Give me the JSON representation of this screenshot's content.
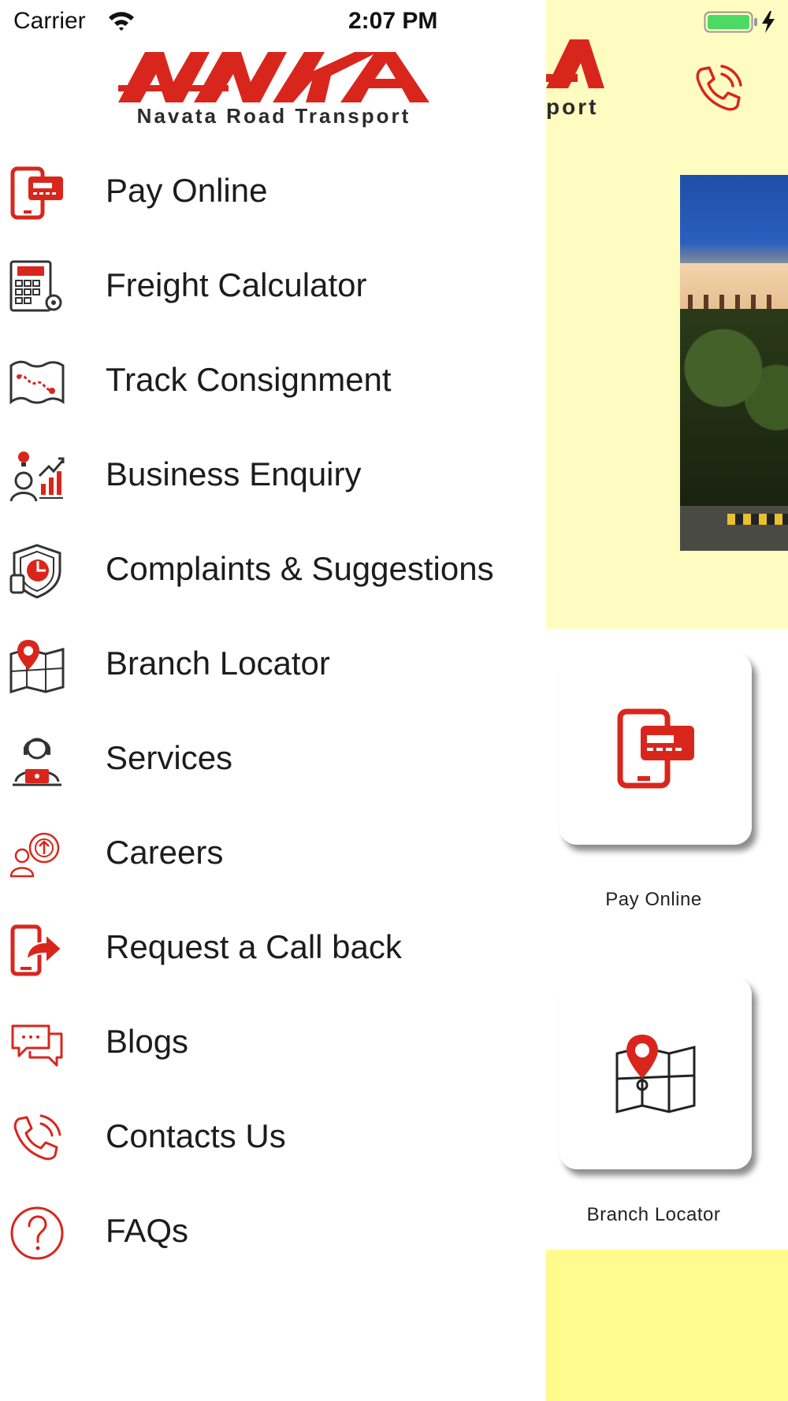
{
  "status_bar": {
    "carrier": "Carrier",
    "time": "2:07 PM"
  },
  "brand": {
    "logo_text": "NAVATA",
    "subtitle": "Navata Road Transport",
    "accent_color": "#d9261c"
  },
  "drawer": {
    "items": [
      {
        "label": "Pay Online",
        "icon": "mobile-payment-icon"
      },
      {
        "label": "Freight Calculator",
        "icon": "calculator-icon"
      },
      {
        "label": "Track Consignment",
        "icon": "map-route-icon"
      },
      {
        "label": "Business Enquiry",
        "icon": "business-growth-icon"
      },
      {
        "label": "Complaints & Suggestions",
        "icon": "shield-feedback-icon"
      },
      {
        "label": "Branch Locator",
        "icon": "map-pin-icon"
      },
      {
        "label": "Services",
        "icon": "support-agent-icon"
      },
      {
        "label": "Careers",
        "icon": "user-upload-icon"
      },
      {
        "label": "Request a Call back",
        "icon": "call-back-icon"
      },
      {
        "label": "Blogs",
        "icon": "chat-bubbles-icon"
      },
      {
        "label": "Contacts Us",
        "icon": "phone-icon"
      },
      {
        "label": "FAQs",
        "icon": "question-icon"
      }
    ]
  },
  "background_app": {
    "header_subtitle_fragment": "port",
    "tiles": [
      {
        "label": "Pay Online",
        "icon": "mobile-payment-icon"
      },
      {
        "label": "Branch Locator",
        "icon": "map-pin-icon"
      }
    ]
  }
}
